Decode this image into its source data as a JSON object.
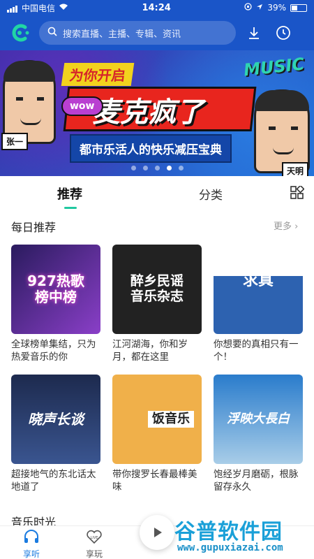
{
  "status_bar": {
    "carrier": "中国电信",
    "time": "14:24",
    "battery": "39%"
  },
  "header": {
    "search_placeholder": "搜索直播、主播、专辑、资讯"
  },
  "banner": {
    "tagline": "为你开启",
    "wow": "wow",
    "headline": "麦克疯了",
    "music_logo": "MUSIC",
    "subtitle": "都市乐活人的快乐减压宝典",
    "left_name": "张一",
    "right_name": "天明",
    "active_dot": 3
  },
  "tabs": {
    "recommend": "推荐",
    "category": "分类"
  },
  "daily": {
    "title": "每日推荐",
    "more": "更多"
  },
  "cards": [
    {
      "cover_text": "927热歌\n榜中榜",
      "desc": "全球榜单集结，只为热爱音乐的你",
      "color": "#5b2e8f"
    },
    {
      "cover_text": "醉乡民谣\n音乐杂志",
      "desc": "江河湖海，你和岁月，都在这里",
      "color": "#2a2a2a"
    },
    {
      "cover_text": "求真",
      "desc": "你想要的真相只有一个！",
      "color": "#3a6fb8"
    },
    {
      "cover_text": "晓声长谈",
      "desc": "超接地气的东北话太地道了",
      "color": "#2a3f6e"
    },
    {
      "cover_text": "饭音乐",
      "desc": "带你搜罗长春最棒美味",
      "color": "#e8a64a"
    },
    {
      "cover_text": "浮映大長白",
      "desc": "饱经岁月磨砺，根脉留存永久",
      "color": "#2c78c8"
    }
  ],
  "section2": {
    "title": "音乐时光"
  },
  "nav": {
    "listen": "享听",
    "play": "享玩"
  },
  "watermark": {
    "big": "谷普软件园",
    "small": "www.gupuxiazai.com"
  }
}
